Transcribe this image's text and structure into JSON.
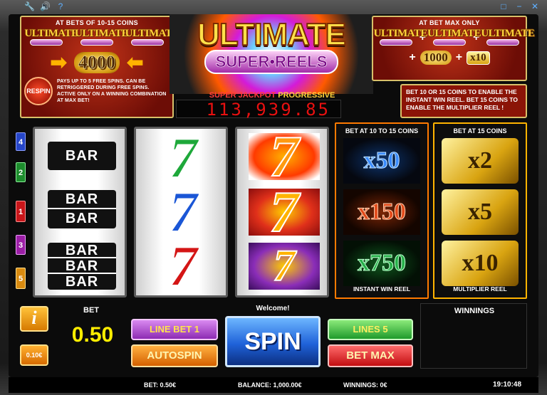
{
  "top_left_icons": [
    "wrench-icon",
    "speaker-icon",
    "help-icon"
  ],
  "top_right_icons": [
    "window-icon",
    "minimize-icon",
    "close-icon"
  ],
  "promo_left": {
    "title": "AT BETS OF 10-15 COINS",
    "logo_word": "ULTIMATE",
    "prize": "4000",
    "respin_label": "RESPIN",
    "respin_text": "PAYS UP TO 5 FREE SPINS. CAN BE RETRIGGERED DURING FREE SPINS. ACTIVE ONLY ON A WINNING COMBINATION AT MAX BET!"
  },
  "logo": {
    "title": "ULTIMATE",
    "subtitle": "SUPER•REELS"
  },
  "jackpot": {
    "label_a": "SUPER JACKPOT",
    "label_b": "PROGRESSIVE",
    "value": "113,939.85"
  },
  "promo_right": {
    "title": "AT BET MAX ONLY",
    "logo_word": "ULTIMATE",
    "plus": "+",
    "amount": "1000",
    "multiplier": "x10",
    "info": "BET 10 OR 15 COINS TO ENABLE THE INSTANT WIN REEL. BET 15 COINS TO ENABLE THE MULTIPLIER REEL !"
  },
  "line_markers": [
    "4",
    "2",
    "1",
    "3",
    "5"
  ],
  "reel1": {
    "single_bar": "BAR",
    "double_bar": [
      "BAR",
      "BAR"
    ],
    "triple_bar": [
      "BAR",
      "BAR",
      "BAR"
    ]
  },
  "reel_seven": "7",
  "instant_reel": {
    "header": "BET AT 10 TO 15 COINS",
    "values": [
      "x50",
      "x150",
      "x750"
    ],
    "footer": "INSTANT WIN REEL"
  },
  "multiplier_reel": {
    "header": "BET AT 15 COINS",
    "values": [
      "x2",
      "x5",
      "x10"
    ],
    "footer": "MULTIPLIER REEL"
  },
  "controls": {
    "info_button": "i",
    "coin_button": "0.10€",
    "bet_label": "BET",
    "bet_value": "0.50",
    "welcome": "Welcome!",
    "line_bet": "LINE BET 1",
    "autospin": "AUTOSPIN",
    "spin": "SPIN",
    "lines": "LINES 5",
    "bet_max": "BET MAX",
    "winnings_label": "WINNINGS"
  },
  "status": {
    "bet": "BET: 0.50€",
    "balance": "BALANCE: 1,000.00€",
    "winnings": "WINNINGS: 0€",
    "time": "19:10:48"
  },
  "colors": {
    "accent_red": "#8b1407",
    "gold": "#ffd23a",
    "jackpot_red": "#e81010",
    "spin_blue": "#1f62d9"
  }
}
